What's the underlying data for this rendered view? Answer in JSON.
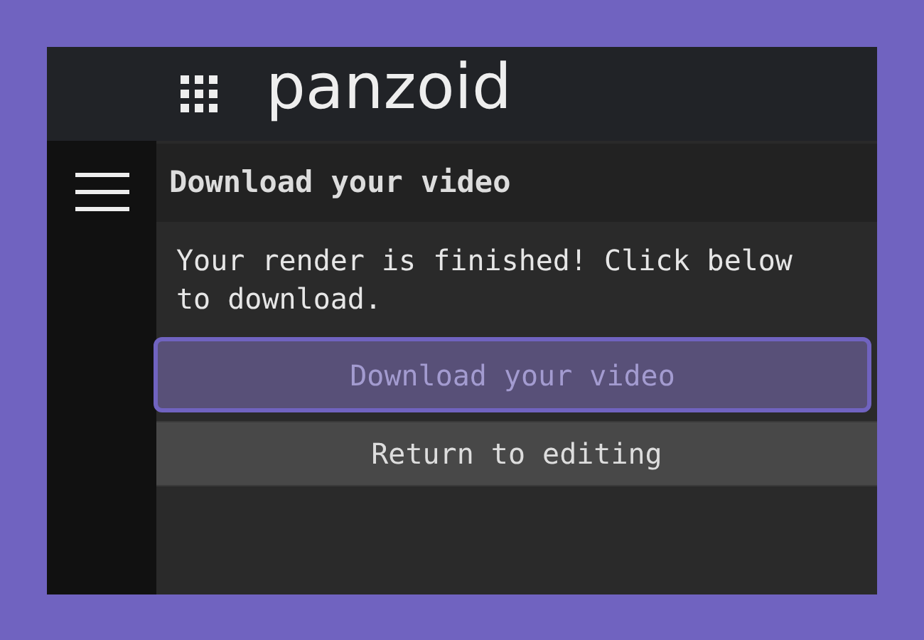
{
  "header": {
    "logo": "panzoid"
  },
  "panel": {
    "title": "Download your video",
    "message": "Your render is finished! Click below to download."
  },
  "buttons": [
    {
      "label": "Download your video",
      "kind": "primary"
    },
    {
      "label": "Return to editing",
      "kind": "secondary"
    }
  ]
}
